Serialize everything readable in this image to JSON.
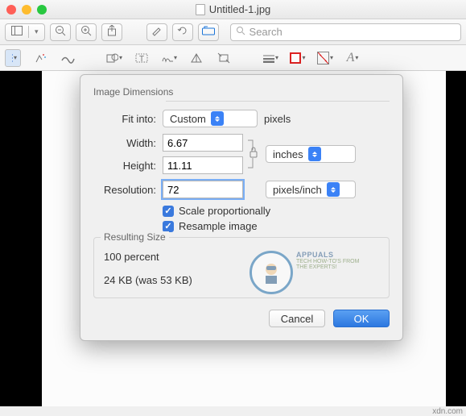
{
  "window": {
    "title": "Untitled-1.jpg"
  },
  "search": {
    "placeholder": "Search"
  },
  "dialog": {
    "section1": "Image Dimensions",
    "fit_into_label": "Fit into:",
    "fit_into_value": "Custom",
    "fit_into_unit": "pixels",
    "width_label": "Width:",
    "width_value": "6.67",
    "height_label": "Height:",
    "height_value": "11.11",
    "size_unit": "inches",
    "resolution_label": "Resolution:",
    "resolution_value": "72",
    "resolution_unit": "pixels/inch",
    "scale_label": "Scale proportionally",
    "resample_label": "Resample image",
    "section2": "Resulting Size",
    "percent_line": "100 percent",
    "size_line": "24 KB (was 53 KB)",
    "cancel": "Cancel",
    "ok": "OK"
  },
  "watermark": {
    "name": "APPUALS",
    "tag": "TECH HOW-TO'S FROM THE EXPERTS!"
  },
  "attrib": "xdn.com"
}
